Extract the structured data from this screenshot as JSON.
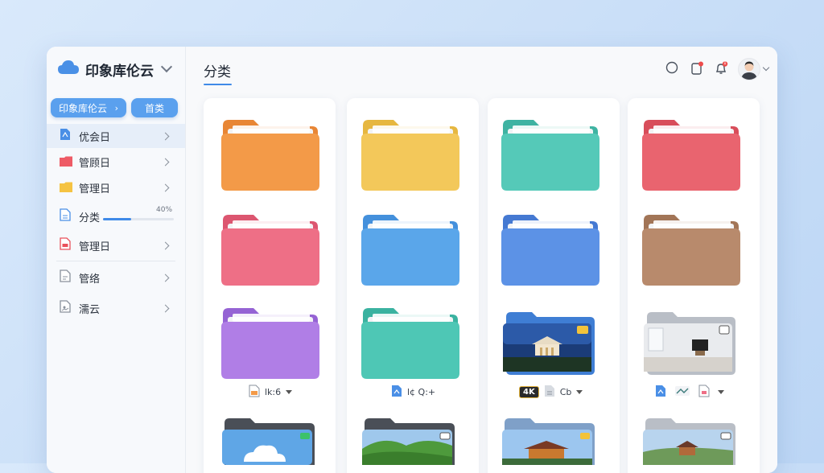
{
  "sidebar": {
    "brand_title": "印象库伦云",
    "crumbs": [
      "印象库伦云",
      "首类"
    ],
    "items": [
      {
        "label": "优会日",
        "icon": "document-blue-icon",
        "color": "#4a8fe6"
      },
      {
        "label": "管顾日",
        "icon": "folder-red-icon",
        "color": "#ee5b66"
      },
      {
        "label": "管理日",
        "icon": "folder-yellow-icon",
        "color": "#f5c342"
      },
      {
        "label": "分类",
        "icon": "document-outline-icon",
        "color": "#4a8fe6",
        "progress_text": "40%",
        "progress": 0.4
      },
      {
        "label": "管理日",
        "icon": "document-red-icon",
        "color": "#e9505b"
      },
      {
        "label": "管络",
        "icon": "document-gray-icon",
        "color": "#8a919c"
      },
      {
        "label": "濡云",
        "icon": "image-doc-icon",
        "color": "#8a919c"
      }
    ]
  },
  "header": {
    "title": "分类",
    "notification_count": "1"
  },
  "folders": [
    {
      "color": "#f39a48",
      "tab": "#e88635"
    },
    {
      "color": "#f3c85a",
      "tab": "#e6b740"
    },
    {
      "color": "#55c9b8",
      "tab": "#3fb3a2"
    },
    {
      "color": "#e9646f",
      "tab": "#d84d5a"
    },
    {
      "color": "#ee6f86",
      "tab": "#dc5670"
    },
    {
      "color": "#5aa6ea",
      "tab": "#4490dc"
    },
    {
      "color": "#5c92e6",
      "tab": "#4579d2"
    },
    {
      "color": "#b88a6c",
      "tab": "#a27557"
    },
    {
      "color": "#b07ee6",
      "tab": "#9563d4"
    },
    {
      "color": "#4ec7b5",
      "tab": "#3ab2a0"
    }
  ],
  "meta_rows": [
    {
      "text": "lk:6"
    },
    {
      "text": "l¢ Q:+"
    },
    {
      "badge": "4K",
      "text": "Cb"
    },
    {
      "text": ""
    }
  ],
  "colors": {
    "accent": "#3f8ae8",
    "chip": "#5aa0ee"
  }
}
